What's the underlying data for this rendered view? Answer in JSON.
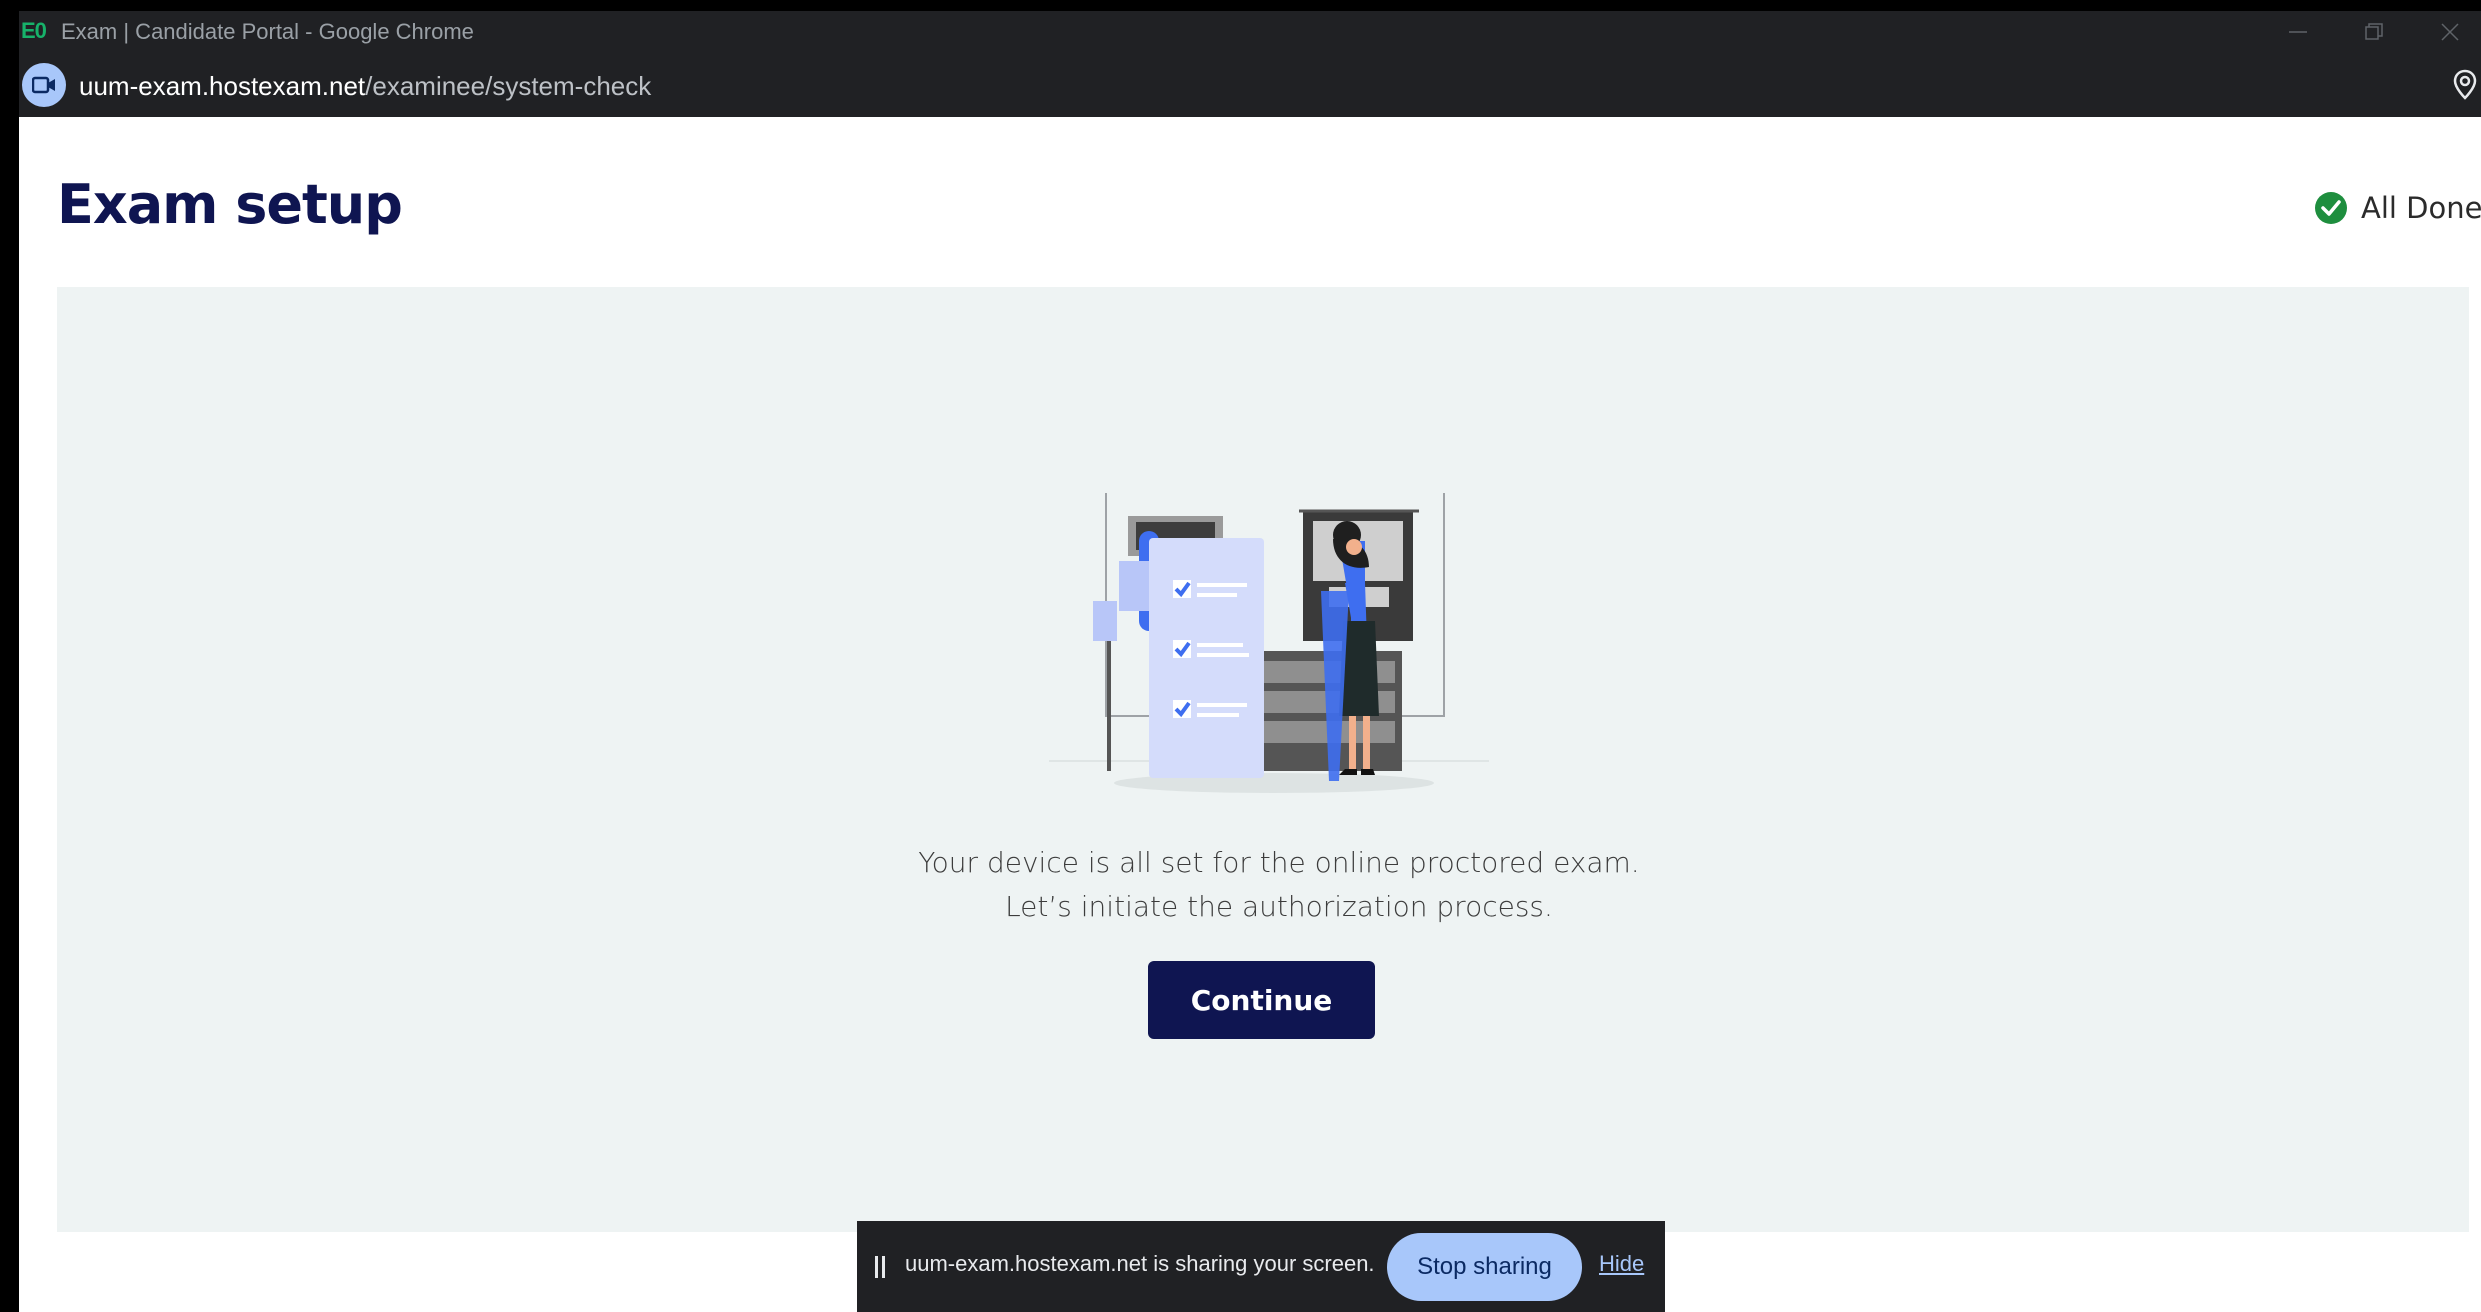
{
  "window": {
    "app_logo": "E0",
    "title": "Exam | Candidate Portal - Google Chrome"
  },
  "addressbar": {
    "url_host": "uum-exam.hostexam.net",
    "url_path": "/examinee/system-check"
  },
  "page": {
    "title": "Exam setup",
    "status_label": "All Done",
    "message_line1": "Your device is all set for the online proctored exam.",
    "message_line2": "Let’s initiate the authorization process.",
    "continue_label": "Continue"
  },
  "sharebar": {
    "text": "uum-exam.hostexam.net is sharing your screen.",
    "stop_label": "Stop sharing",
    "hide_label": "Hide"
  },
  "icons": {
    "site": "video-camera-icon",
    "location": "location-pin-icon",
    "status": "check-circle-icon"
  },
  "colors": {
    "brand_navy": "#0f1551",
    "panel_bg": "#eef3f3",
    "success_green": "#1e8e3e",
    "chrome_dark": "#202124",
    "chrome_blue": "#a8c7fa",
    "illustration_blue": "#3e6ef0"
  }
}
